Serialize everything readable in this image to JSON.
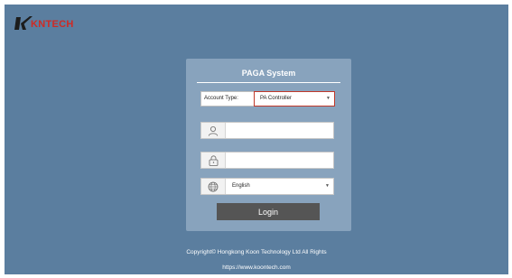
{
  "brand": {
    "name": "KNTECH",
    "logo_color": "#cf2a24"
  },
  "colors": {
    "background": "#5b7e9f",
    "panel": "#88a3bd",
    "button": "#555555",
    "select_border": "#c0392b"
  },
  "login_panel": {
    "title": "PAGA System",
    "account_type": {
      "label": "Account Type:",
      "value": "PA Controller"
    },
    "username": {
      "icon": "user-icon",
      "value": ""
    },
    "password": {
      "icon": "lock-icon",
      "value": ""
    },
    "language": {
      "icon": "globe-icon",
      "value": "English"
    },
    "login_label": "Login"
  },
  "footer": {
    "copyright": "Copyright© Hongkong Koon Technology Ltd All Rights",
    "url": "https://www.koontech.com"
  }
}
